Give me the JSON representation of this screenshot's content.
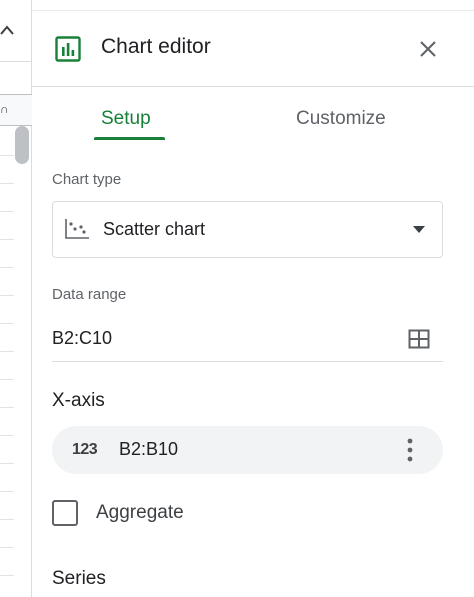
{
  "editor": {
    "title": "Chart editor",
    "tabs": {
      "setup": "Setup",
      "customize": "Customize",
      "active": "Setup"
    },
    "chart_type": {
      "label": "Chart type",
      "value": "Scatter chart"
    },
    "data_range": {
      "label": "Data range",
      "value": "B2:C10"
    },
    "x_axis": {
      "heading": "X-axis",
      "type_icon_text": "123",
      "value": "B2:B10"
    },
    "aggregate": {
      "label": "Aggregate",
      "checked": false
    },
    "series": {
      "heading": "Series"
    }
  },
  "sheet": {
    "column_header_fragment": "∩"
  },
  "colors": {
    "accent": "#188038",
    "text": "#202124",
    "muted": "#5f6368",
    "divider": "#dadce0",
    "chip": "#f1f3f4"
  },
  "icons": [
    "chart-icon",
    "close-icon",
    "scatter-chart-icon",
    "dropdown-arrow-icon",
    "grid-select-icon",
    "number-type-icon",
    "more-vert-icon",
    "checkbox-icon",
    "caret-up-icon"
  ]
}
